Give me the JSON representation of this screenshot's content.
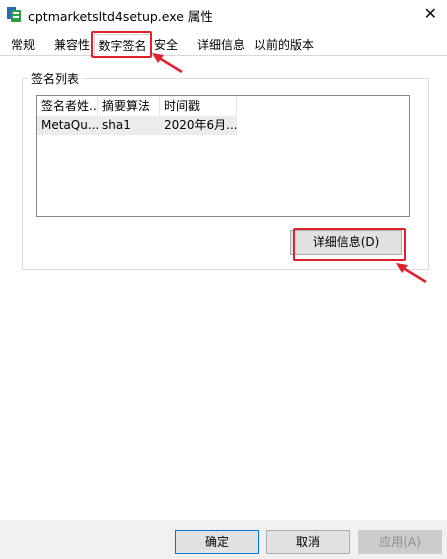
{
  "window": {
    "title": "cptmarketsltd4setup.exe 属性",
    "close_glyph": "✕"
  },
  "tabs": [
    {
      "label": "常规"
    },
    {
      "label": "兼容性"
    },
    {
      "label": "数字签名",
      "active": true
    },
    {
      "label": "安全"
    },
    {
      "label": "详细信息"
    },
    {
      "label": "以前的版本"
    }
  ],
  "signature_list": {
    "group_label": "签名列表",
    "columns": [
      "签名者姓...",
      "摘要算法",
      "时间戳"
    ],
    "rows": [
      {
        "signer": "MetaQu...",
        "digest": "sha1",
        "timestamp": "2020年6月..."
      }
    ]
  },
  "details_button": {
    "label": "详细信息(D)"
  },
  "footer": {
    "ok_label": "确定",
    "cancel_label": "取消",
    "apply_label": "应用(A)"
  },
  "colors": {
    "callout": "#e0202a",
    "primary_border": "#0078d7",
    "app_icon_green": "#2f9e44",
    "app_icon_blue": "#2b6cb0"
  },
  "icons": {
    "app": "app-installer-icon",
    "annotation": "red-arrow-icon"
  }
}
